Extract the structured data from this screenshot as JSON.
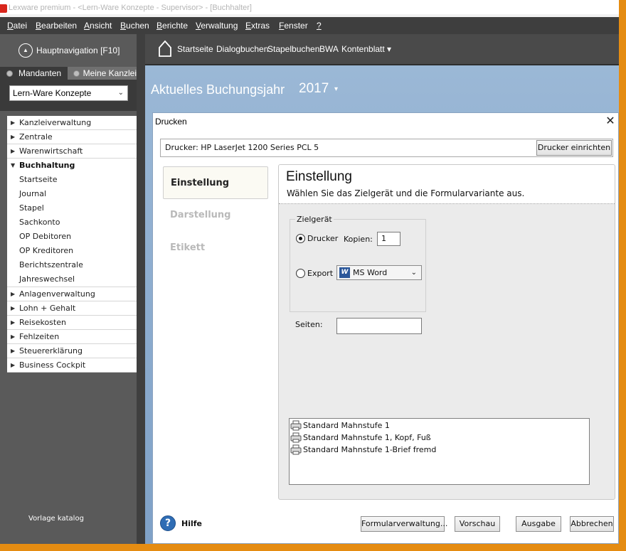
{
  "window": {
    "title": "Lexware premium - <Lern-Ware Konzepte - Supervisor> - [Buchhalter]"
  },
  "menu": [
    {
      "label": "Datei",
      "hot": "D",
      "rest": "atei"
    },
    {
      "label": "Bearbeiten",
      "hot": "B",
      "rest": "earbeiten"
    },
    {
      "label": "Ansicht",
      "hot": "A",
      "rest": "nsicht"
    },
    {
      "label": "Buchen",
      "hot": "B",
      "rest": "uchen"
    },
    {
      "label": "Berichte",
      "hot": "B",
      "rest": "erichte"
    },
    {
      "label": "Verwaltung",
      "hot": "V",
      "rest": "erwaltung"
    },
    {
      "label": "Extras",
      "hot": "E",
      "rest": "xtras"
    },
    {
      "label": "Fenster",
      "hot": "F",
      "rest": "enster"
    },
    {
      "label": "?",
      "hot": "?",
      "rest": ""
    }
  ],
  "sidebar": {
    "main_nav_label": "Hauptnavigation [F10]",
    "tab_clients": "Mandanten",
    "tab_office": "Meine Kanzlei",
    "client_value": "Lern-Ware Konzepte",
    "groups": [
      "Kanzleiverwaltung",
      "Zentrale",
      "Warenwirtschaft",
      "Buchhaltung",
      "Anlagenverwaltung",
      "Lohn + Gehalt",
      "Reisekosten",
      "Fehlzeiten",
      "Steuererklärung",
      "Business Cockpit"
    ],
    "buchhaltung_items": [
      "Startseite",
      "Journal",
      "Stapel",
      "Sachkonto",
      "OP Debitoren",
      "OP Kreditoren",
      "Berichtszentrale",
      "Jahreswechsel"
    ],
    "footer_text": "Vorlage katalog"
  },
  "topnav": {
    "links": [
      "Startseite",
      "Dialogbuchen",
      "Stapelbuchen",
      "BWA",
      "Kontenblatt ▾"
    ]
  },
  "content": {
    "year_label": "Aktuelles Buchungsjahr",
    "year_value": "2017"
  },
  "dialog": {
    "title": "Drucken",
    "printer_text": "Drucker: HP LaserJet 1200 Series PCL 5",
    "printer_setup_button": "Drucker einrichten",
    "nav": [
      "Einstellung",
      "Darstellung",
      "Etikett"
    ],
    "panel_title": "Einstellung",
    "panel_subtitle": "Wählen Sie das Zielgerät und die Formularvariante aus.",
    "target_group_label": "Zielgerät",
    "radio_printer": "Drucker",
    "copies_label": "Kopien:",
    "copies_value": "1",
    "radio_export": "Export",
    "export_format": "MS Word",
    "export_format_icon": "W",
    "pages_label": "Seiten:",
    "pages_value": "",
    "variants": [
      "Standard Mahnstufe 1",
      "Standard Mahnstufe 1, Kopf, Fuß",
      "Standard Mahnstufe 1-Brief fremd"
    ],
    "help_label": "Hilfe",
    "help_icon": "?",
    "buttons": {
      "form_admin": "Formularverwaltung...",
      "preview": "Vorschau",
      "output": "Ausgabe",
      "cancel": "Abbrechen"
    }
  },
  "colors": {
    "frame": "#e58c12",
    "menubar": "#3e3e3e",
    "sidebar": "#5a5a5a",
    "content_blue": "#8fb0d2",
    "accent_blue": "#2f6db5"
  }
}
